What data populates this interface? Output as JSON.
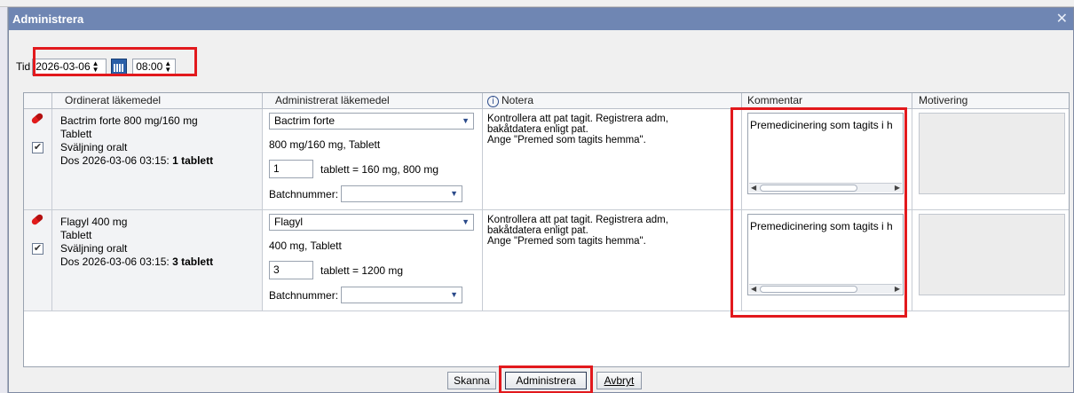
{
  "dialog": {
    "title": "Administrera",
    "close_glyph": "✕"
  },
  "time": {
    "label": "Tid",
    "date": "2026-03-06",
    "time": "08:00",
    "spin_glyph": "▲▼"
  },
  "table": {
    "headers": [
      "",
      "Ordinerat läkemedel",
      "Administrerat läkemedel",
      "Notera",
      "Kommentar",
      "Motivering"
    ],
    "info_glyph": "i"
  },
  "rows": [
    {
      "ordered": [
        "Bactrim forte 800 mg/160 mg",
        "Tablett",
        "Sväljning oralt"
      ],
      "dose_prefix": "Dos 2026-03-06 03:15: ",
      "dose_bold": "1 tablett",
      "drug_select": "Bactrim forte",
      "strength": "800 mg/160 mg, Tablett",
      "qty": "1",
      "qty_text": "tablett = 160 mg, 800 mg",
      "batch_label": "Batchnummer:",
      "batch_value": "",
      "note": [
        "Kontrollera att pat tagit. Registrera adm,",
        "bakåtdatera enligt pat.",
        "Ange \"Premed som tagits hemma\"."
      ],
      "comment": "Premedicinering som tagits i h",
      "checked": true
    },
    {
      "ordered": [
        "Flagyl 400 mg",
        "Tablett",
        "Sväljning oralt"
      ],
      "dose_prefix": "Dos 2026-03-06 03:15: ",
      "dose_bold": "3 tablett",
      "drug_select": "Flagyl",
      "strength": "400 mg, Tablett",
      "qty": "3",
      "qty_text": "tablett = 1200 mg",
      "batch_label": "Batchnummer:",
      "batch_value": "",
      "note": [
        "Kontrollera att pat tagit. Registrera adm,",
        "bakåtdatera enligt pat.",
        "Ange \"Premed som tagits hemma\"."
      ],
      "comment": "Premedicinering som tagits i h",
      "checked": true
    }
  ],
  "buttons": {
    "scan": "Skanna",
    "administer": "Administrera",
    "cancel": "Avbryt"
  },
  "colors": {
    "titlebar": "#6f86b3",
    "highlight": "#e2191d"
  }
}
